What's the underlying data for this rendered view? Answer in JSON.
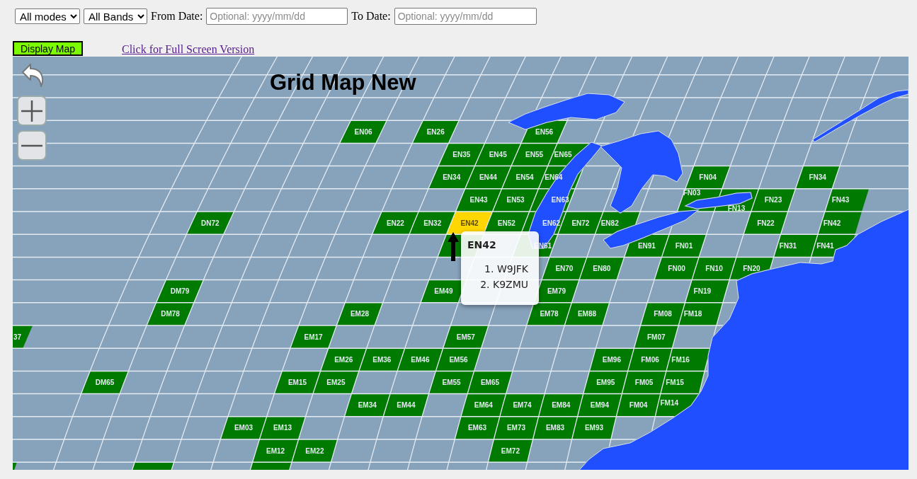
{
  "filters": {
    "mode_select": "All modes",
    "band_select": "All Bands",
    "from_label": "From Date:",
    "from_placeholder": "Optional: yyyy/mm/dd",
    "to_label": "To Date:",
    "to_placeholder": "Optional: yyyy/mm/dd"
  },
  "display_button": "Display Map",
  "fullscreen_link": "Click for Full Screen Version",
  "map": {
    "title": "Grid Map New",
    "cells": [
      {
        "label": "EN06",
        "selected": false
      },
      {
        "label": "EN26",
        "selected": false
      },
      {
        "label": "EN56",
        "selected": false
      },
      {
        "label": "EN35",
        "selected": false
      },
      {
        "label": "EN45",
        "selected": false
      },
      {
        "label": "EN55",
        "selected": false
      },
      {
        "label": "EN65",
        "selected": false
      },
      {
        "label": "EN34",
        "selected": false
      },
      {
        "label": "EN44",
        "selected": false
      },
      {
        "label": "EN54",
        "selected": false
      },
      {
        "label": "EN64",
        "selected": false
      },
      {
        "label": "FN04",
        "selected": false
      },
      {
        "label": "FN34",
        "selected": false
      },
      {
        "label": "EN43",
        "selected": false
      },
      {
        "label": "EN53",
        "selected": false
      },
      {
        "label": "EN63",
        "selected": false
      },
      {
        "label": "FN03",
        "selected": false
      },
      {
        "label": "FN13",
        "selected": false
      },
      {
        "label": "FN23",
        "selected": false
      },
      {
        "label": "FN43",
        "selected": false
      },
      {
        "label": "DN72",
        "selected": false
      },
      {
        "label": "EN22",
        "selected": false
      },
      {
        "label": "EN32",
        "selected": false
      },
      {
        "label": "EN42",
        "selected": true
      },
      {
        "label": "EN52",
        "selected": false
      },
      {
        "label": "EN62",
        "selected": false
      },
      {
        "label": "EN72",
        "selected": false
      },
      {
        "label": "EN82",
        "selected": false
      },
      {
        "label": "FN22",
        "selected": false
      },
      {
        "label": "FN42",
        "selected": false
      },
      {
        "selected": false
      },
      {
        "label": "EN61",
        "selected": false
      },
      {
        "label": "EN91",
        "selected": false
      },
      {
        "label": "FN01",
        "selected": false
      },
      {
        "label": "FN31",
        "selected": false
      },
      {
        "label": "FN41",
        "selected": false
      },
      {
        "label": "EN70",
        "selected": false
      },
      {
        "label": "EN80",
        "selected": false
      },
      {
        "label": "FN00",
        "selected": false
      },
      {
        "label": "FN10",
        "selected": false
      },
      {
        "label": "FN20",
        "selected": false
      },
      {
        "label": "DM79",
        "selected": false
      },
      {
        "label": "EM49",
        "selected": false
      },
      {
        "label": "EM79",
        "selected": false
      },
      {
        "label": "FN19",
        "selected": false
      },
      {
        "label": "DM78",
        "selected": false
      },
      {
        "label": "EM28",
        "selected": false
      },
      {
        "label": "EM78",
        "selected": false
      },
      {
        "label": "EM88",
        "selected": false
      },
      {
        "label": "FM08",
        "selected": false
      },
      {
        "label": "FM18",
        "selected": false
      },
      {
        "label": "37",
        "selected": false
      },
      {
        "label": "EM17",
        "selected": false
      },
      {
        "label": "EM57",
        "selected": false
      },
      {
        "label": "FM07",
        "selected": false
      },
      {
        "label": "EM26",
        "selected": false
      },
      {
        "label": "EM36",
        "selected": false
      },
      {
        "label": "EM46",
        "selected": false
      },
      {
        "label": "EM56",
        "selected": false
      },
      {
        "label": "EM96",
        "selected": false
      },
      {
        "label": "FM06",
        "selected": false
      },
      {
        "label": "FM16",
        "selected": false
      },
      {
        "label": "DM65",
        "selected": false
      },
      {
        "label": "EM15",
        "selected": false
      },
      {
        "label": "EM25",
        "selected": false
      },
      {
        "label": "EM55",
        "selected": false
      },
      {
        "label": "EM65",
        "selected": false
      },
      {
        "label": "EM95",
        "selected": false
      },
      {
        "label": "FM05",
        "selected": false
      },
      {
        "label": "FM15",
        "selected": false
      },
      {
        "label": "EM34",
        "selected": false
      },
      {
        "label": "EM44",
        "selected": false
      },
      {
        "label": "EM64",
        "selected": false
      },
      {
        "label": "EM74",
        "selected": false
      },
      {
        "label": "EM84",
        "selected": false
      },
      {
        "label": "EM94",
        "selected": false
      },
      {
        "label": "FM04",
        "selected": false
      },
      {
        "label": "FM14",
        "selected": false
      },
      {
        "label": "EM03",
        "selected": false
      },
      {
        "label": "EM13",
        "selected": false
      },
      {
        "label": "EM63",
        "selected": false
      },
      {
        "label": "EM73",
        "selected": false
      },
      {
        "label": "EM83",
        "selected": false
      },
      {
        "label": "EM93",
        "selected": false
      },
      {
        "label": "EM12",
        "selected": false
      },
      {
        "label": "EM22",
        "selected": false
      },
      {
        "label": "EM72",
        "selected": false
      },
      {
        "selected": false
      },
      {
        "selected": false
      },
      {
        "selected": false
      }
    ],
    "popup": {
      "title": "EN42",
      "items": [
        {
          "number": "1.",
          "call": "W9JFK"
        },
        {
          "number": "2.",
          "call": "K9ZMU"
        }
      ]
    }
  }
}
